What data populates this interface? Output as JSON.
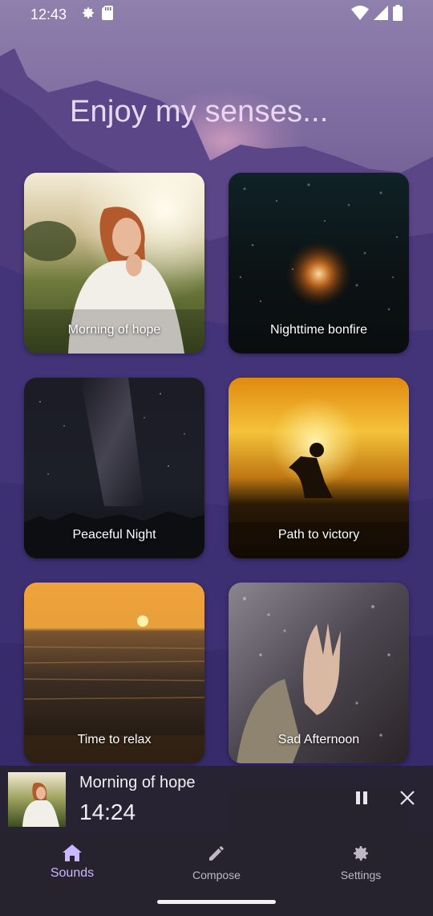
{
  "status_bar": {
    "time": "12:43"
  },
  "headline": "Enjoy my senses...",
  "cards": [
    {
      "title": "Morning of hope"
    },
    {
      "title": "Nighttime bonfire"
    },
    {
      "title": "Peaceful Night"
    },
    {
      "title": "Path to victory"
    },
    {
      "title": "Time to relax"
    },
    {
      "title": "Sad Afternoon"
    }
  ],
  "player": {
    "title": "Morning of hope",
    "time": "14:24"
  },
  "nav": {
    "items": [
      {
        "label": "Sounds",
        "icon": "home-icon",
        "active": true
      },
      {
        "label": "Compose",
        "icon": "pencil-icon",
        "active": false
      },
      {
        "label": "Settings",
        "icon": "gear-icon",
        "active": false
      }
    ]
  },
  "colors": {
    "accent": "#c9b8ff",
    "nav_bg": "#26222e",
    "headline": "#ead8f2"
  }
}
